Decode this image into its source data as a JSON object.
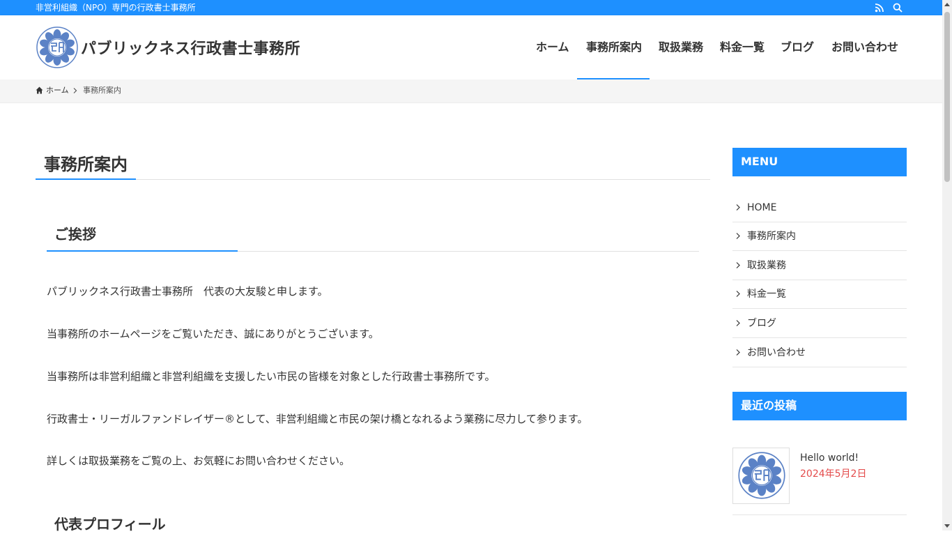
{
  "topbar": {
    "tagline": "非営利組織（NPO）専門の行政書士事務所",
    "rss_icon": "rss-icon",
    "search_icon": "search-icon"
  },
  "header": {
    "site_title": "パブリックネス行政書士事務所",
    "logo_icon": "flower-emblem-logo"
  },
  "nav": {
    "items": [
      {
        "label": "ホーム"
      },
      {
        "label": "事務所案内",
        "current": true
      },
      {
        "label": "取扱業務"
      },
      {
        "label": "料金一覧"
      },
      {
        "label": "ブログ"
      },
      {
        "label": "お問い合わせ"
      }
    ]
  },
  "breadcrumb": {
    "home": "ホーム",
    "current": "事務所案内"
  },
  "main": {
    "page_title": "事務所案内",
    "section1": {
      "heading": "ご挨拶",
      "paragraphs": [
        "パブリックネス行政書士事務所　代表の大友駿と申します。",
        "当事務所のホームページをご覧いただき、誠にありがとうございます。",
        "当事務所は非営利組織と非営利組織を支援したい市民の皆様を対象とした行政書士事務所です。",
        "行政書士・リーガルファンドレイザー®として、非営利組織と市民の架け橋となれるよう業務に尽力して参ります。",
        "詳しくは取扱業務をご覧の上、お気軽にお問い合わせください。"
      ]
    },
    "section2": {
      "heading": "代表プロフィール"
    }
  },
  "sidebar": {
    "menu_title": "MENU",
    "menu_items": [
      {
        "label": "HOME"
      },
      {
        "label": "事務所案内"
      },
      {
        "label": "取扱業務"
      },
      {
        "label": "料金一覧"
      },
      {
        "label": "ブログ"
      },
      {
        "label": "お問い合わせ"
      }
    ],
    "recent_title": "最近の投稿",
    "recent_posts": [
      {
        "title": "Hello world!",
        "date": "2024年5月2日"
      }
    ]
  },
  "colors": {
    "accent": "#1e90ff",
    "date": "#e44b4b"
  }
}
